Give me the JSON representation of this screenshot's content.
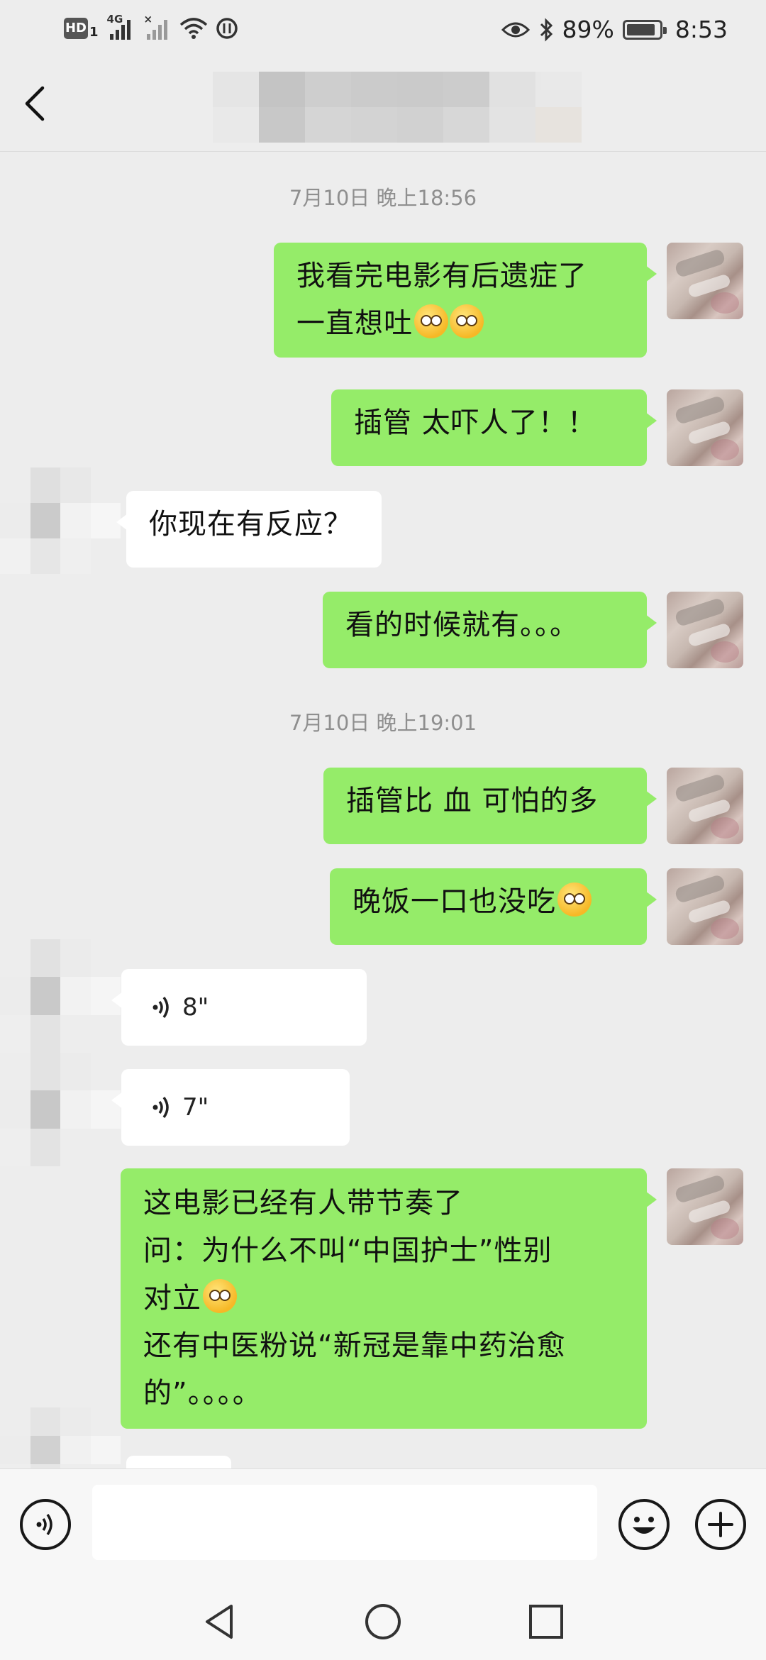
{
  "status_bar": {
    "hd": "HD",
    "hd_sub": "1",
    "network": "4G",
    "battery_percent": "89%",
    "battery_level": 0.89,
    "time": "8:53"
  },
  "header": {
    "back_icon": "chevron-left-icon"
  },
  "messages": {
    "ts1": "7月10日 晚上18:56",
    "m1_line1": "我看完电影有后遗症了",
    "m1_line2": "一直想吐",
    "m2": "插管 太吓人了！！",
    "m3": "你现在有反应？",
    "m4": "看的时候就有。。。",
    "ts2": "7月10日 晚上19:01",
    "m5": "插管比 血 可怕的多",
    "m6": "晚饭一口也没吃",
    "v1": "8\"",
    "v2": "7\"",
    "m7_line1": "这电影已经有人带节奏了",
    "m7_line2": "问：为什么不叫“中国护士”性别",
    "m7_line3": "对立",
    "m7_line4": "还有中医粉说“新冠是靠中药治愈",
    "m7_line5": "的”。。。。"
  },
  "input_bar": {
    "voice_icon": "voice-icon",
    "emoji_icon": "emoji-icon",
    "plus_icon": "plus-icon",
    "placeholder": ""
  },
  "nav": {
    "back": "back-triangle-icon",
    "home": "home-circle-icon",
    "recent": "recent-square-icon"
  }
}
